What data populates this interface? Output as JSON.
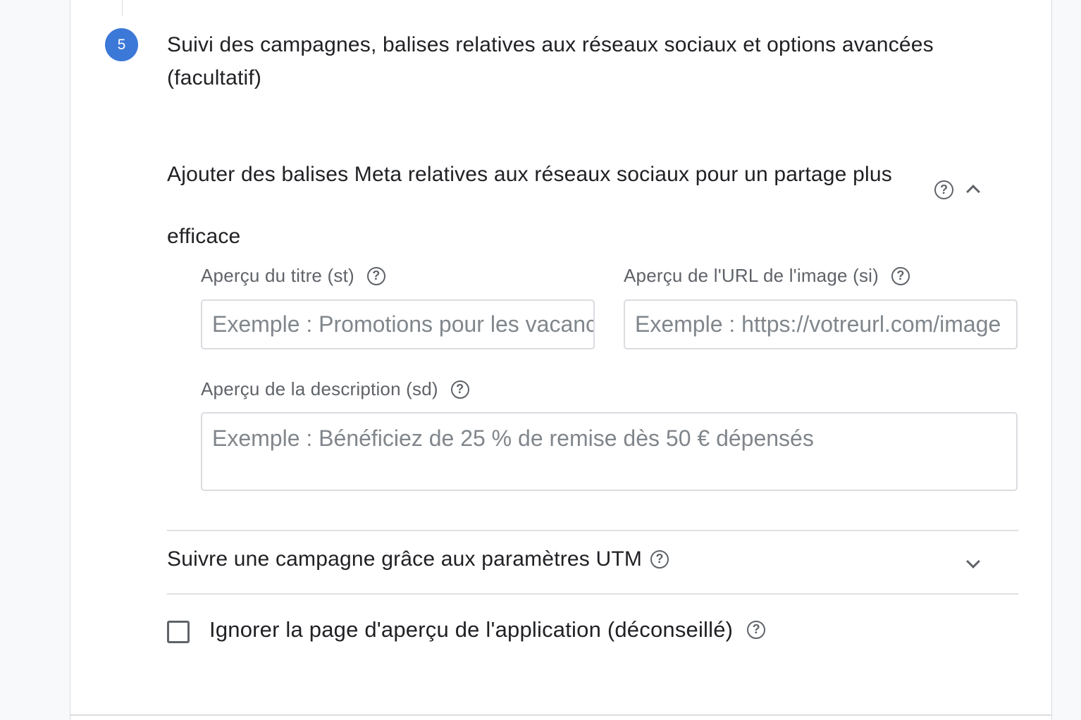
{
  "step": {
    "number": "5",
    "title": "Suivi des campagnes, balises relatives aux réseaux sociaux et options avancées (facultatif)"
  },
  "social_meta": {
    "header": "Ajouter des balises Meta relatives aux réseaux sociaux pour un partage plus efficace",
    "expanded": true,
    "fields": {
      "title": {
        "label": "Aperçu du titre (st)",
        "placeholder": "Exemple : Promotions pour les vacances",
        "value": ""
      },
      "image_url": {
        "label": "Aperçu de l'URL de l'image (si)",
        "placeholder": "Exemple : https://votreurl.com/image",
        "value": ""
      },
      "description": {
        "label": "Aperçu de la description (sd)",
        "placeholder": "Exemple : Bénéficiez de 25 % de remise dès 50 € dépensés",
        "value": ""
      }
    }
  },
  "utm": {
    "label": "Suivre une campagne grâce aux paramètres UTM",
    "expanded": false
  },
  "skip_preview": {
    "label": "Ignorer la page d'aperçu de l'application (déconseillé)",
    "checked": false
  },
  "colors": {
    "accent": "#3c78d8",
    "text": "#202124",
    "muted": "#5f6368",
    "border": "#dadce0"
  },
  "icons": [
    "help-circle-icon",
    "chevron-up-icon",
    "chevron-down-icon",
    "checkbox-unchecked-icon"
  ]
}
